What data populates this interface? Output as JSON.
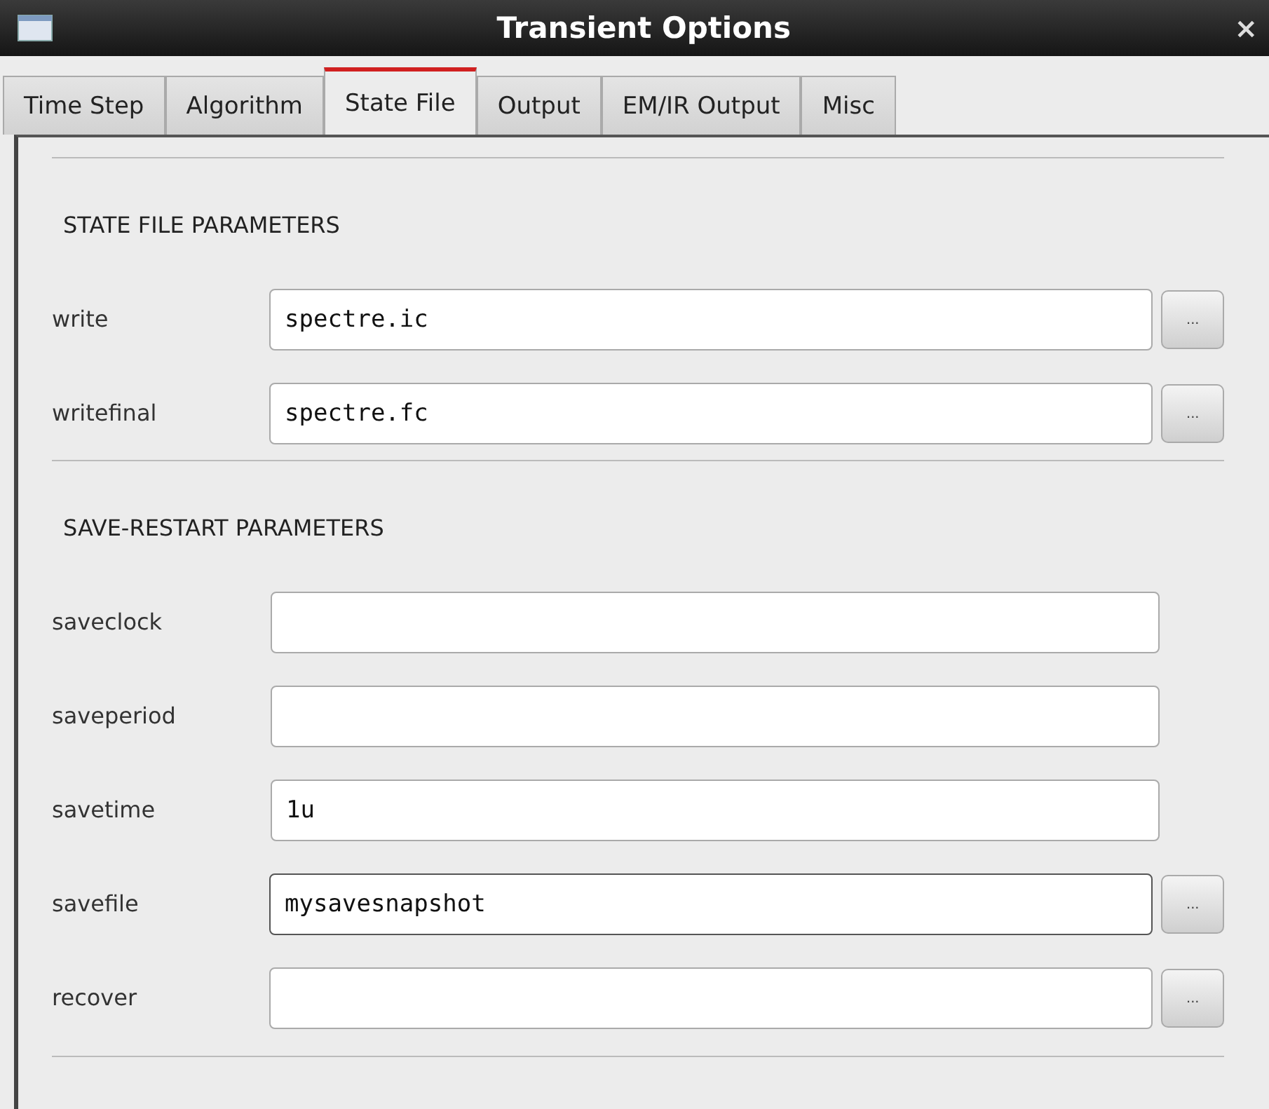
{
  "window": {
    "title": "Transient Options",
    "close": "×"
  },
  "tabs": [
    {
      "label": "Time Step",
      "selected": false
    },
    {
      "label": "Algorithm",
      "selected": false
    },
    {
      "label": "State File",
      "selected": true
    },
    {
      "label": "Output",
      "selected": false
    },
    {
      "label": "EM/IR Output",
      "selected": false
    },
    {
      "label": "Misc",
      "selected": false
    }
  ],
  "sections": [
    {
      "title": "STATE FILE PARAMETERS",
      "fields": [
        {
          "label": "write",
          "value": "spectre.ic",
          "browse": "...",
          "focused": false
        },
        {
          "label": "writefinal",
          "value": "spectre.fc",
          "browse": "...",
          "focused": false
        }
      ]
    },
    {
      "title": "SAVE-RESTART PARAMETERS",
      "fields": [
        {
          "label": "saveclock",
          "focused": false
        },
        {
          "label": "saveperiod",
          "focused": false
        },
        {
          "label": "savetime",
          "value": "1u",
          "focused": false
        },
        {
          "label": "savefile",
          "value": "mysavesnapshot",
          "browse": "...",
          "focused": true
        },
        {
          "label": "recover",
          "browse": "...",
          "focused": false
        }
      ]
    }
  ]
}
